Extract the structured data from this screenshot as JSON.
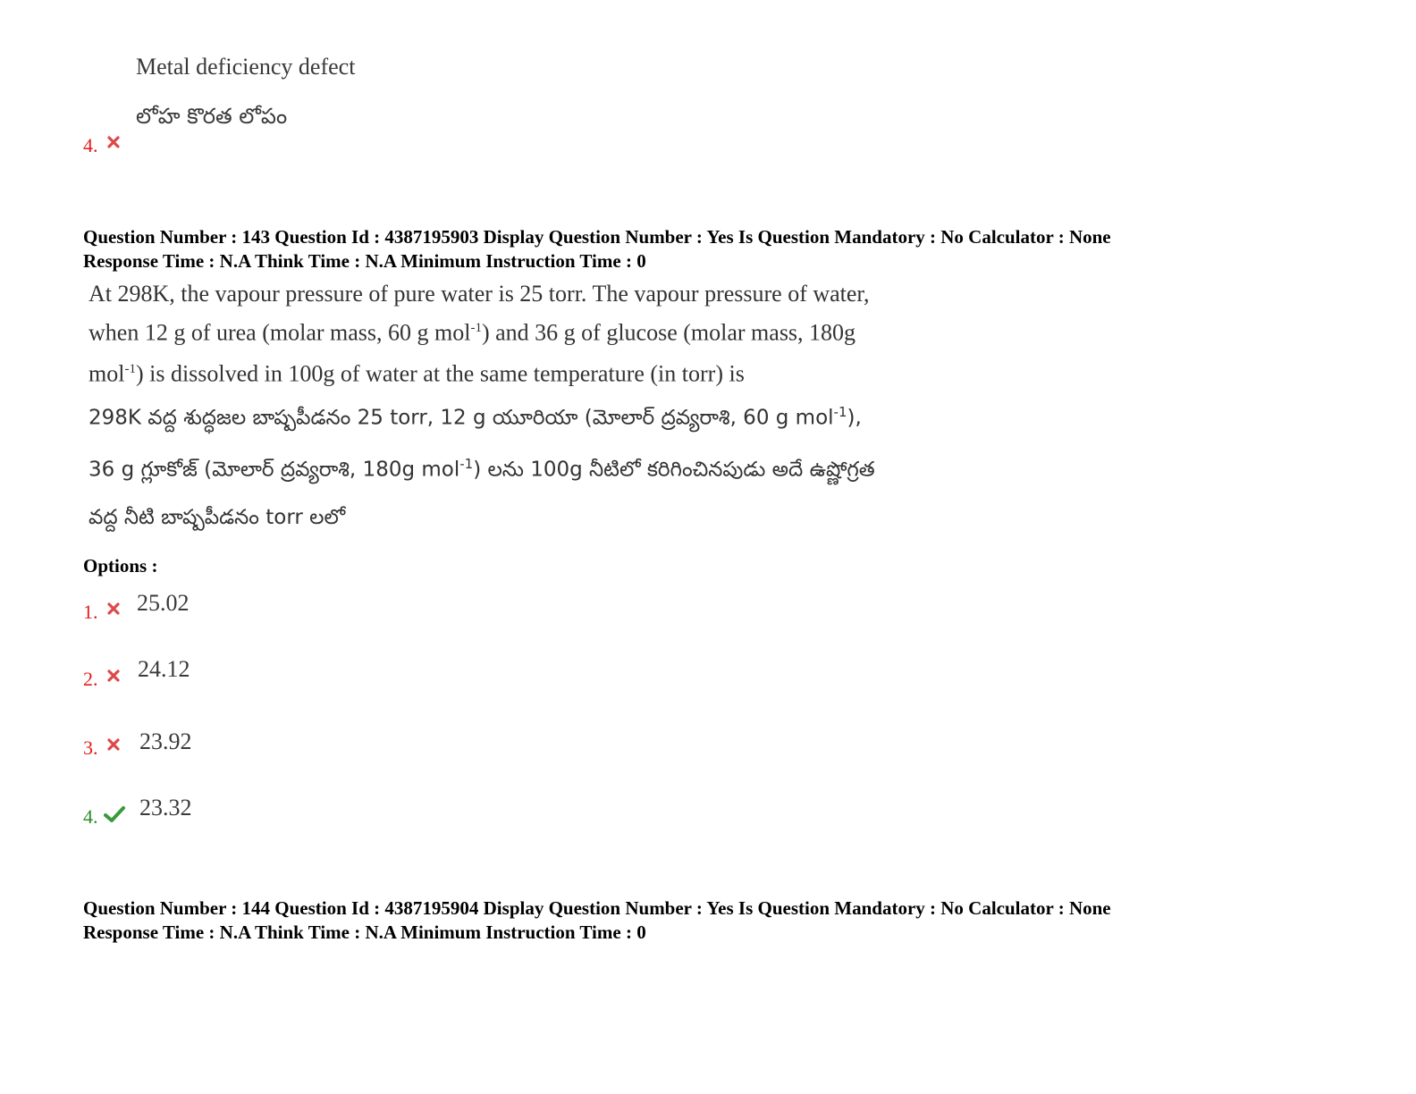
{
  "prev_question": {
    "option4": {
      "number": "4.",
      "text_en": "Metal deficiency defect",
      "text_te": "లోహ కొరత లోపం",
      "status_icon": "cross-icon"
    }
  },
  "q143": {
    "meta_line1": "Question Number : 143 Question Id : 4387195903 Display Question Number : Yes Is Question Mandatory : No Calculator : None",
    "meta_line2": "Response Time : N.A Think Time : N.A Minimum Instruction Time : 0",
    "question_en": {
      "line1": "At 298K, the vapour pressure of pure water is 25 torr.  The vapour pressure of water,",
      "line2_a": "when 12 g of urea (molar mass, 60 g mol",
      "line2_sup": "-1",
      "line2_b": ") and 36 g of glucose (molar mass, 180g",
      "line3_a": "mol",
      "line3_sup": "-1",
      "line3_b": ") is dissolved in 100g of water at the same temperature (in torr) is"
    },
    "question_te": {
      "line1_a": "298K వద్ద శుద్ధజల బాష్పపీడనం 25 torr, 12 g యూరియా (మోలార్ ద్రవ్యరాశి, 60 g mol",
      "line1_sup": "-1",
      "line1_b": "),",
      "line2_a": "36 g గ్లూకోజ్ (మోలార్ ద్రవ్యరాశి, 180g mol",
      "line2_sup": "-1",
      "line2_b": ") లను 100g నీటిలో కరిగించినపుడు అదే ఉష్ణోగ్రత",
      "line3": "వద్ద నీటి బాష్పపీడనం torr లలో"
    },
    "options_label": "Options :",
    "options": [
      {
        "number": "1.",
        "value": "25.02",
        "status_icon": "cross-icon",
        "correct": false
      },
      {
        "number": "2.",
        "value": "24.12",
        "status_icon": "cross-icon",
        "correct": false
      },
      {
        "number": "3.",
        "value": "23.92",
        "status_icon": "cross-icon",
        "correct": false
      },
      {
        "number": "4.",
        "value": "23.32",
        "status_icon": "check-icon",
        "correct": true
      }
    ]
  },
  "q144": {
    "meta_line1": "Question Number : 144 Question Id : 4387195904 Display Question Number : Yes Is Question Mandatory : No Calculator : None",
    "meta_line2": "Response Time : N.A Think Time : N.A Minimum Instruction Time : 0"
  },
  "colors": {
    "wrong": "#e41b1b",
    "correct": "#2e8b2e",
    "text": "#000000"
  }
}
